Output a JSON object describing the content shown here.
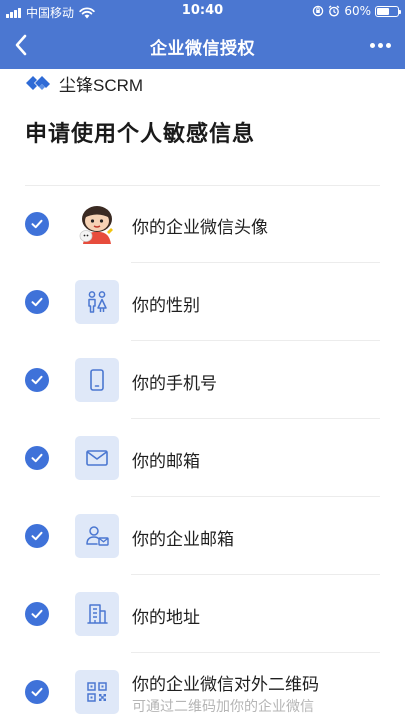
{
  "status_bar": {
    "carrier": "中国移动",
    "time": "10:40",
    "battery_percent": "60%",
    "battery_level": 0.6
  },
  "nav": {
    "title": "企业微信授权"
  },
  "brand": {
    "name": "尘锋SCRM"
  },
  "page_title": "申请使用个人敏感信息",
  "permissions": [
    {
      "label": "你的企业微信头像",
      "icon": "avatar-image",
      "checked": true
    },
    {
      "label": "你的性别",
      "icon": "gender-icon",
      "checked": true
    },
    {
      "label": "你的手机号",
      "icon": "phone-icon",
      "checked": true
    },
    {
      "label": "你的邮箱",
      "icon": "mail-icon",
      "checked": true
    },
    {
      "label": "你的企业邮箱",
      "icon": "enterprise-mail-icon",
      "checked": true
    },
    {
      "label": "你的地址",
      "icon": "building-icon",
      "checked": true
    },
    {
      "label": "你的企业微信对外二维码",
      "sublabel": "可通过二维码加你的企业微信",
      "icon": "qrcode-icon",
      "checked": true
    }
  ],
  "colors": {
    "header_bg": "#4b77d1",
    "check_blue": "#3f72d9",
    "icon_bg": "#dfe8f8",
    "icon_stroke": "#4b77d1"
  }
}
